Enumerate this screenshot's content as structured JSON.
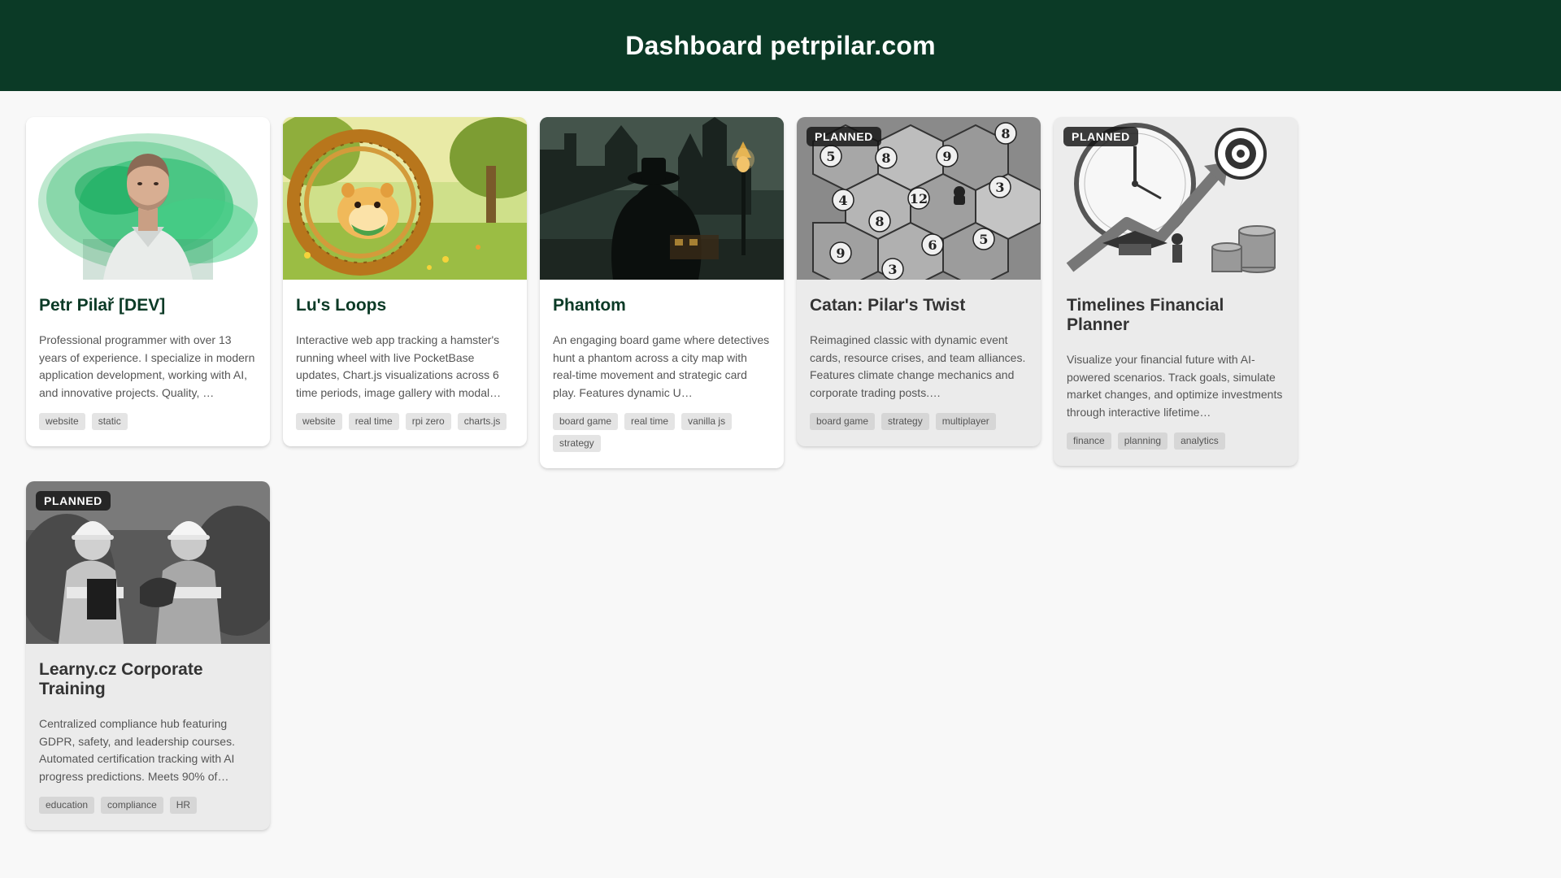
{
  "header": {
    "title": "Dashboard petrpilar.com"
  },
  "colors": {
    "header_bg": "#0b3a26",
    "accent": "#0b3a26",
    "page_bg": "#f8f8f8"
  },
  "cards": [
    {
      "title": "Petr Pilař [DEV]",
      "description": "Professional programmer with over 13 years of experience. I specialize in modern application development, working with AI, and innovative projects. Quality, …",
      "tags": [
        "website",
        "static"
      ],
      "planned": false,
      "image": "portrait-with-green-watercolor"
    },
    {
      "title": "Lu's Loops",
      "description": "Interactive web app tracking a hamster's running wheel with live PocketBase updates, Chart.js visualizations across 6 time periods, image gallery with modal…",
      "tags": [
        "website",
        "real time",
        "rpi zero",
        "charts.js"
      ],
      "planned": false,
      "image": "hamster-in-wheel"
    },
    {
      "title": "Phantom",
      "description": "An engaging board game where detectives hunt a phantom across a city map with real-time movement and strategic card play. Features dynamic U…",
      "tags": [
        "board game",
        "real time",
        "vanilla js",
        "strategy"
      ],
      "planned": false,
      "image": "phantom-night-city"
    },
    {
      "title": "Catan: Pilar's Twist",
      "description": "Reimagined classic with dynamic event cards, resource crises, and team alliances. Features climate change mechanics and corporate trading posts.…",
      "tags": [
        "board game",
        "strategy",
        "multiplayer"
      ],
      "planned": true,
      "badge": "PLANNED",
      "image": "catan-hex-board"
    },
    {
      "title": "Timelines Financial Planner",
      "description": "Visualize your financial future with AI-powered scenarios. Track goals, simulate market changes, and optimize investments through interactive lifetime…",
      "tags": [
        "finance",
        "planning",
        "analytics"
      ],
      "planned": true,
      "badge": "PLANNED",
      "image": "clock-growth-chart"
    },
    {
      "title": "Learny.cz Corporate Training",
      "description": "Centralized compliance hub featuring GDPR, safety, and leadership courses. Automated certification tracking with AI progress predictions. Meets 90% of…",
      "tags": [
        "education",
        "compliance",
        "HR"
      ],
      "planned": true,
      "badge": "PLANNED",
      "image": "workers-hard-hats"
    }
  ]
}
